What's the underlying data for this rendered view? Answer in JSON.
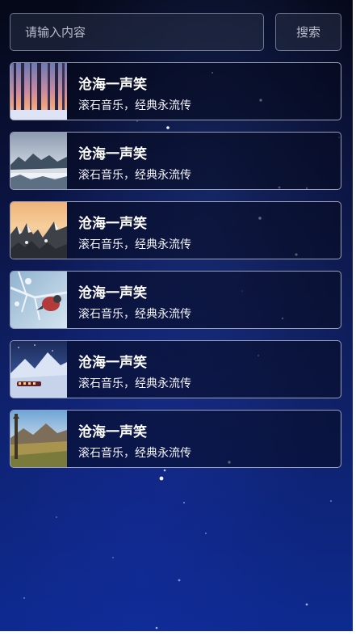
{
  "search": {
    "placeholder": "请输入内容",
    "button_label": "搜索"
  },
  "results": [
    {
      "title": "沧海一声笑",
      "subtitle": "滚石音乐，经典永流传",
      "thumbnail": "winter-forest-sunset"
    },
    {
      "title": "沧海一声笑",
      "subtitle": "滚石音乐，经典永流传",
      "thumbnail": "misty-snowy-mountains"
    },
    {
      "title": "沧海一声笑",
      "subtitle": "滚石音乐，经典永流传",
      "thumbnail": "snowy-rock-peaks-sunrise"
    },
    {
      "title": "沧海一声笑",
      "subtitle": "滚石音乐，经典永流传",
      "thumbnail": "red-bird-on-frosty-branch"
    },
    {
      "title": "沧海一声笑",
      "subtitle": "滚石音乐，经典永流传",
      "thumbnail": "snowy-night-train"
    },
    {
      "title": "沧海一声笑",
      "subtitle": "滚石音乐，经典永流传",
      "thumbnail": "mountain-meadow-landscape"
    }
  ]
}
